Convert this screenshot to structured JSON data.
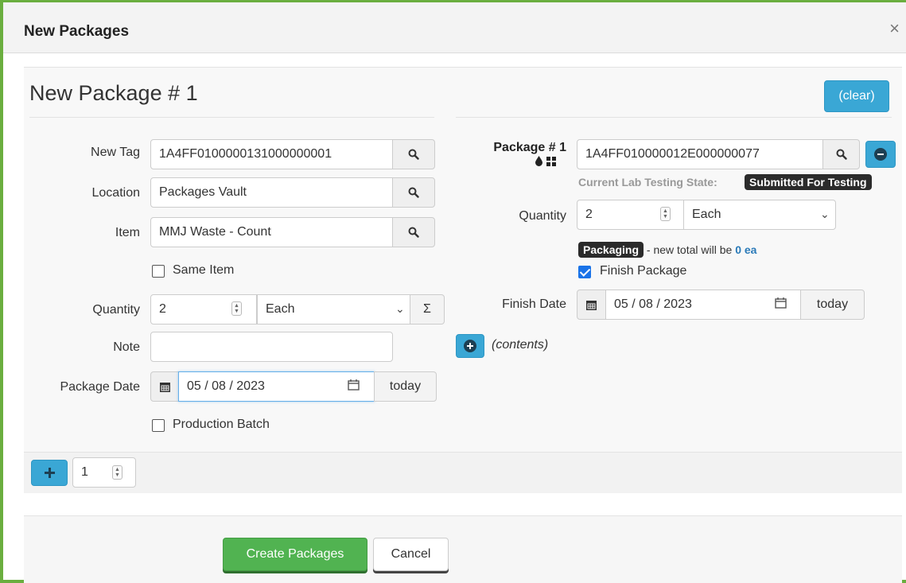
{
  "dialog": {
    "title": "New Packages",
    "close_label": "×"
  },
  "package": {
    "title": "New Package # 1",
    "clear_label": "(clear)"
  },
  "left": {
    "new_tag": {
      "label": "New Tag",
      "value": "1A4FF0100000131000000001"
    },
    "location": {
      "label": "Location",
      "value": "Packages Vault"
    },
    "item": {
      "label": "Item",
      "value": "MMJ Waste - Count"
    },
    "same_item": {
      "label": "Same Item",
      "checked": false
    },
    "quantity": {
      "label": "Quantity",
      "value": "2",
      "unit": "Each",
      "sum_label": "Σ"
    },
    "note": {
      "label": "Note",
      "value": ""
    },
    "package_date": {
      "label": "Package Date",
      "value": "05 / 08 / 2023",
      "today_label": "today"
    },
    "production_batch": {
      "label": "Production Batch",
      "checked": false
    }
  },
  "right": {
    "source_label": "Package # 1",
    "source_tag": "1A4FF010000012E000000077",
    "lab_state_label": "Current Lab Testing State:",
    "lab_state_value": "Submitted For Testing",
    "quantity": {
      "label": "Quantity",
      "value": "2",
      "unit": "Each"
    },
    "packaging_badge": "Packaging",
    "new_total_text": " - new total will be ",
    "new_total_value": "0 ea",
    "finish_package": {
      "label": "Finish Package",
      "checked": true
    },
    "finish_date": {
      "label": "Finish Date",
      "value": "05 / 08 / 2023",
      "today_label": "today"
    },
    "contents_label": "(contents)"
  },
  "add_row": {
    "count": "1"
  },
  "footer": {
    "create_label": "Create Packages",
    "cancel_label": "Cancel"
  },
  "colors": {
    "accent_border": "#6aae3f",
    "info": "#3aa7d5",
    "success": "#4cae4c"
  }
}
